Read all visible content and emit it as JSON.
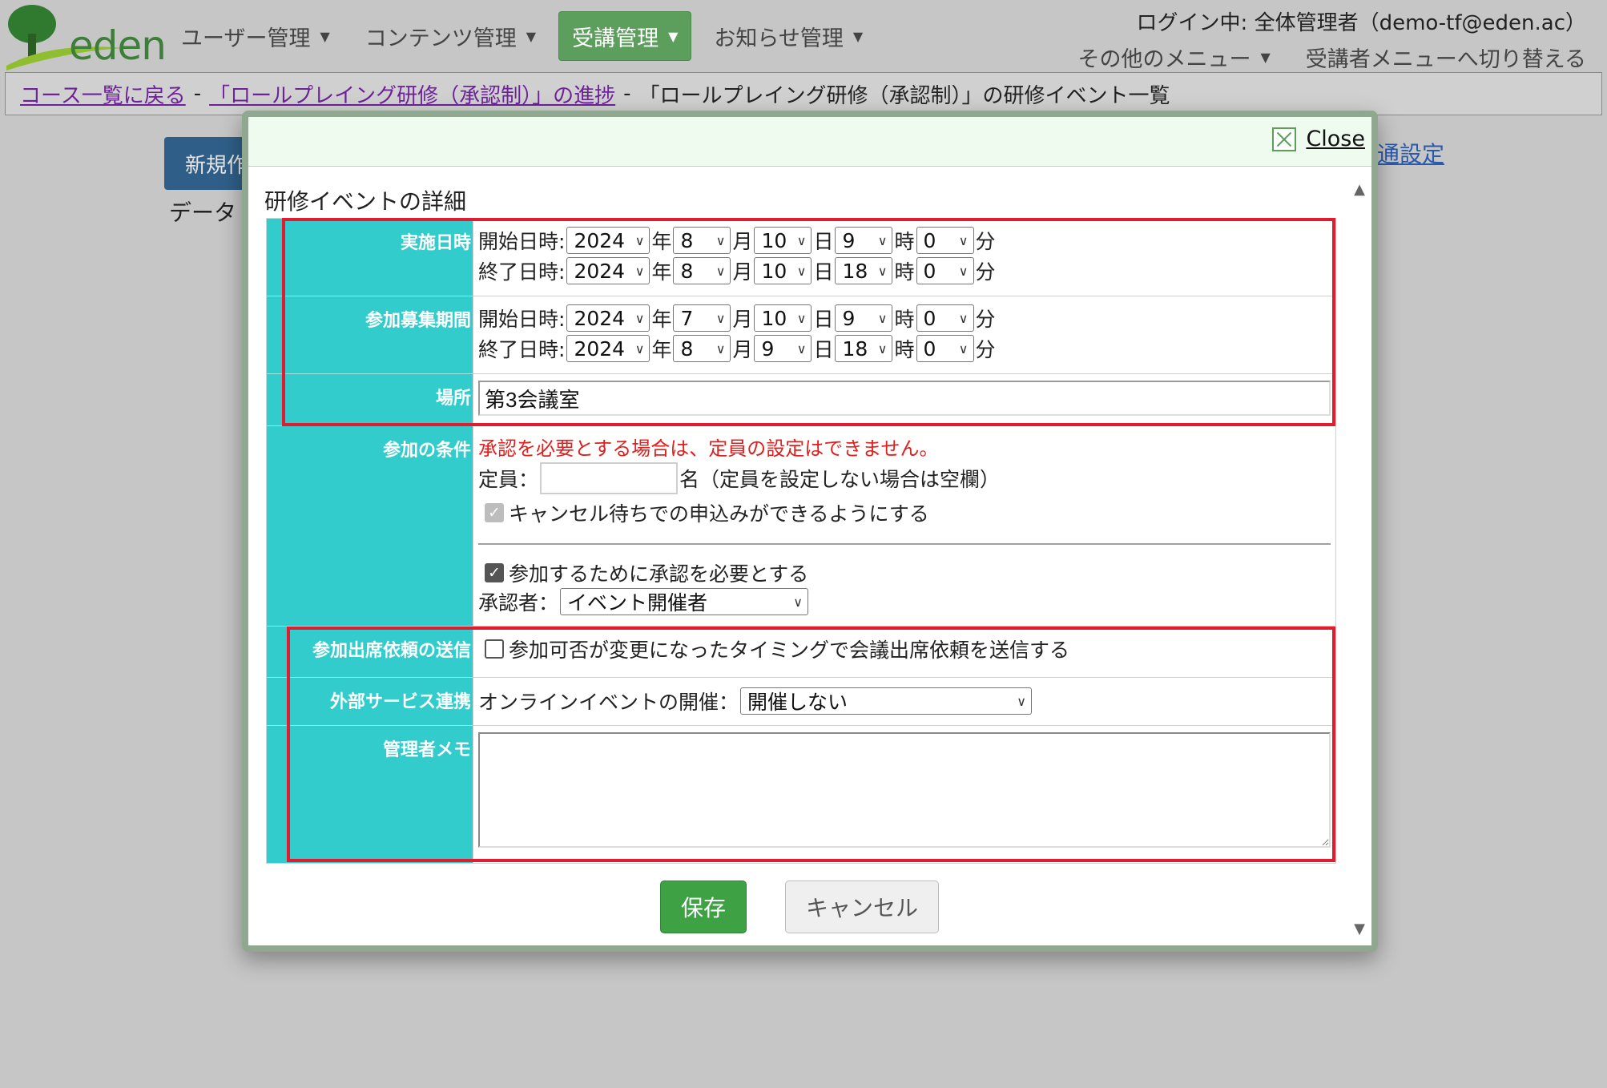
{
  "header": {
    "logo_text": "eden",
    "nav": [
      {
        "label": "ユーザー管理"
      },
      {
        "label": "コンテンツ管理"
      },
      {
        "label": "受講管理"
      },
      {
        "label": "お知らせ管理"
      }
    ],
    "login_info": "ログイン中: 全体管理者（demo-tf@eden.ac）",
    "other_menu": "その他のメニュー",
    "switch_menu": "受講者メニューへ切り替える"
  },
  "breadcrumb": {
    "items": [
      "コース一覧に戻る",
      "「ロールプレイング研修（承認制）」の進捗",
      "「ロールプレイング研修（承認制）」の研修イベント一覧"
    ],
    "separator": "-"
  },
  "background": {
    "new_button": "新規作成",
    "data_label": "データ",
    "right_link": "通設定"
  },
  "modal": {
    "close_label": "Close",
    "title": "研修イベントの詳細",
    "units": {
      "year": "年",
      "month": "月",
      "day": "日",
      "hour": "時",
      "minute": "分"
    },
    "labels": {
      "start": "開始日時:",
      "end": "終了日時:"
    },
    "event_date": {
      "label": "実施日時",
      "start": {
        "year": "2024",
        "month": "8",
        "day": "10",
        "hour": "9",
        "minute": "0"
      },
      "end": {
        "year": "2024",
        "month": "8",
        "day": "10",
        "hour": "18",
        "minute": "0"
      }
    },
    "recruit_period": {
      "label": "参加募集期間",
      "start": {
        "year": "2024",
        "month": "7",
        "day": "10",
        "hour": "9",
        "minute": "0"
      },
      "end": {
        "year": "2024",
        "month": "8",
        "day": "9",
        "hour": "18",
        "minute": "0"
      }
    },
    "place": {
      "label": "場所",
      "value": "第3会議室"
    },
    "conditions": {
      "label": "参加の条件",
      "warning": "承認を必要とする場合は、定員の設定はできません。",
      "capacity_label": "定員：",
      "capacity_value": "",
      "capacity_suffix": "名（定員を設定しない場合は空欄）",
      "waitlist_label": "キャンセル待ちでの申込みができるようにする",
      "approval_label": "参加するために承認を必要とする",
      "approver_label": "承認者：",
      "approver_value": "イベント開催者"
    },
    "attendance_request": {
      "label": "参加出席依頼の送信",
      "checkbox_label": "参加可否が変更になったタイミングで会議出席依頼を送信する"
    },
    "external_service": {
      "label": "外部サービス連携",
      "online_label": "オンラインイベントの開催：",
      "online_value": "開催しない"
    },
    "admin_memo": {
      "label": "管理者メモ",
      "value": ""
    },
    "save_label": "保存",
    "cancel_label": "キャンセル"
  },
  "colors": {
    "label_bg": "#33cccc",
    "highlight": "#e01c2e",
    "save_button": "#3ea143",
    "nav_active": "#5c9e5c",
    "warning_text": "#e01f1f"
  }
}
